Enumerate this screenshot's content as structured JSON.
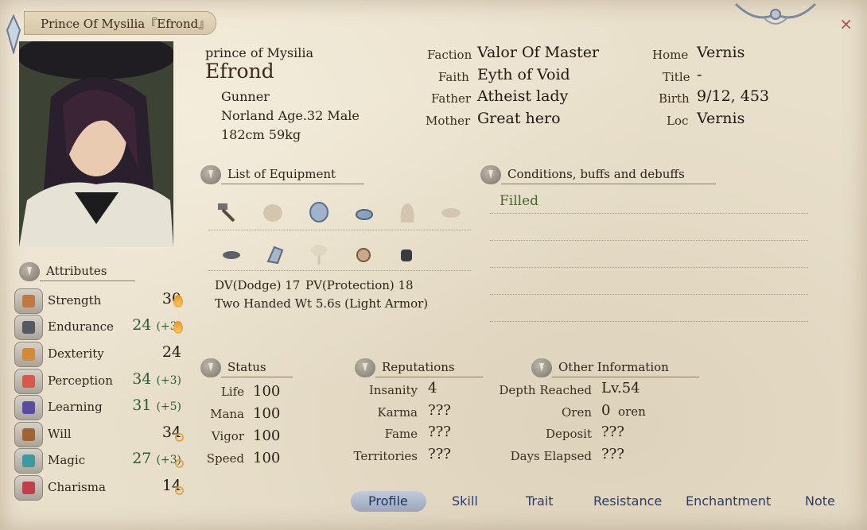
{
  "window": {
    "title": "Prince Of Mysilia『Efrond』",
    "close_label": "×"
  },
  "character": {
    "alias": "prince of Mysilia",
    "name": "Efrond",
    "class": "Gunner",
    "race_line": "Norland Age.32 Male",
    "body_line": "182cm 59kg"
  },
  "info": {
    "faction_label": "Faction",
    "faction": "Valor Of Master",
    "faith_label": "Faith",
    "faith": "Eyth of Void",
    "father_label": "Father",
    "father": "Atheist lady",
    "mother_label": "Mother",
    "mother": "Great hero",
    "home_label": "Home",
    "home": "Vernis",
    "title_label": "Title",
    "title": "-",
    "birth_label": "Birth",
    "birth": "9/12, 453",
    "loc_label": "Loc",
    "loc": "Vernis"
  },
  "equipment": {
    "heading": "List of Equipment",
    "icons_row1": [
      "hammer-icon",
      "empty-slot-icon",
      "helmet-icon",
      "ring-icon",
      "empty-slot-icon",
      "empty-slot-icon"
    ],
    "icons_row2": [
      "gloves-icon",
      "boots-icon",
      "empty-slot-icon",
      "amulet-icon",
      "bag-icon"
    ],
    "dv": "DV(Dodge) 17",
    "pv": "PV(Protection) 18",
    "weight_line": "Two Handed Wt 5.6s (Light Armor)"
  },
  "conditions": {
    "heading": "Conditions, buffs and debuffs",
    "items": [
      "Filled"
    ]
  },
  "attributes": {
    "heading": "Attributes",
    "items": [
      {
        "name": "Strength",
        "value": "30",
        "bonus": "",
        "icon": "strength-icon",
        "potential": "flame"
      },
      {
        "name": "Endurance",
        "value": "24",
        "bonus": "(+3)",
        "icon": "endurance-icon",
        "potential": "flame"
      },
      {
        "name": "Dexterity",
        "value": "24",
        "bonus": "",
        "icon": "dexterity-icon",
        "potential": ""
      },
      {
        "name": "Perception",
        "value": "34",
        "bonus": "(+3)",
        "icon": "perception-icon",
        "potential": ""
      },
      {
        "name": "Learning",
        "value": "31",
        "bonus": "(+5)",
        "icon": "learning-icon",
        "potential": ""
      },
      {
        "name": "Will",
        "value": "34",
        "bonus": "",
        "icon": "will-icon",
        "potential": "dot"
      },
      {
        "name": "Magic",
        "value": "27",
        "bonus": "(+3)",
        "icon": "magic-icon",
        "potential": "dot"
      },
      {
        "name": "Charisma",
        "value": "14",
        "bonus": "",
        "icon": "charisma-icon",
        "potential": "dot"
      }
    ]
  },
  "status": {
    "heading": "Status",
    "items": [
      {
        "label": "Life",
        "value": "100"
      },
      {
        "label": "Mana",
        "value": "100"
      },
      {
        "label": "Vigor",
        "value": "100"
      },
      {
        "label": "Speed",
        "value": "100"
      }
    ]
  },
  "reputations": {
    "heading": "Reputations",
    "items": [
      {
        "label": "Insanity",
        "value": "4"
      },
      {
        "label": "Karma",
        "value": "???"
      },
      {
        "label": "Fame",
        "value": "???"
      },
      {
        "label": "Territories",
        "value": "???"
      }
    ]
  },
  "other": {
    "heading": "Other Information",
    "items": [
      {
        "label": "Depth Reached",
        "value": "Lv.54",
        "unit": ""
      },
      {
        "label": "Oren",
        "value": "0",
        "unit": "oren"
      },
      {
        "label": "Deposit",
        "value": "???",
        "unit": ""
      },
      {
        "label": "Days Elapsed",
        "value": "???",
        "unit": ""
      }
    ]
  },
  "tabs": [
    "Profile",
    "Skill",
    "Trait",
    "Resistance",
    "Enchantment",
    "Note"
  ],
  "active_tab": "Profile",
  "colors": {
    "parchment": "#e9e0cc",
    "green_stat": "#2f5a3a",
    "tab_text": "#2a3a6a",
    "close": "#a45050"
  }
}
